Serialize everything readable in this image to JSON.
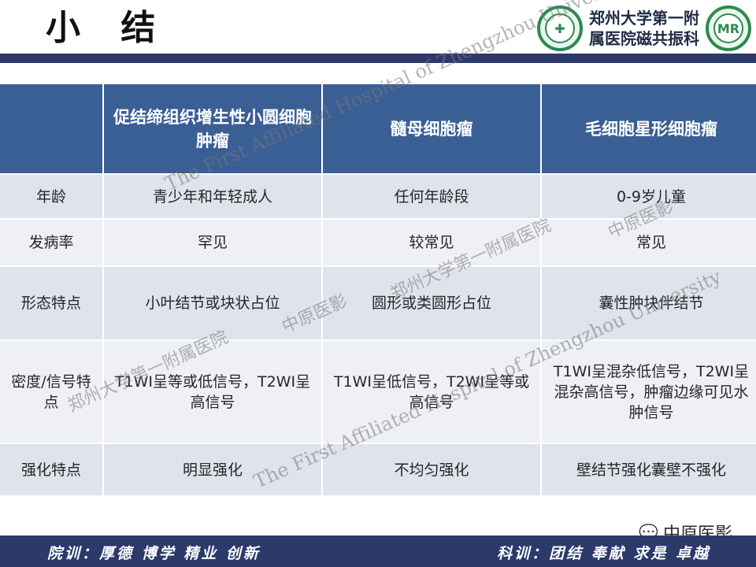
{
  "slide": {
    "title": "小 结",
    "department_lines": [
      "郑州大学第一附",
      "属医院磁共振科"
    ]
  },
  "table": {
    "columns": [
      "",
      "促结缔组织增生性小圆细胞肿瘤",
      "髓母细胞瘤",
      "毛细胞星形细胞瘤"
    ],
    "rows": [
      {
        "label": "年龄",
        "values": [
          "青少年和年轻成人",
          "任何年龄段",
          "0-9岁儿童"
        ]
      },
      {
        "label": "发病率",
        "values": [
          "罕见",
          "较常见",
          "常见"
        ]
      },
      {
        "label": "形态特点",
        "values": [
          "小叶结节或块状占位",
          "圆形或类圆形占位",
          "囊性肿块伴结节"
        ]
      },
      {
        "label": "密度/信号特点",
        "values": [
          "T1WI呈等或低信号，T2WI呈高信号",
          "T1WI呈低信号，T2WI呈等或高信号",
          "T1WI呈混杂低信号，T2WI呈混杂高信号，肿瘤边缘可见水肿信号"
        ]
      },
      {
        "label": "强化特点",
        "values": [
          "明显强化",
          "不均匀强化",
          "壁结节强化囊壁不强化"
        ]
      }
    ]
  },
  "watermarks": {
    "english": "The First Affiliated Hospital of Zhengzhou University",
    "chinese_hospital": "郑州大学第一附属医院",
    "chinese_short": "中原医影"
  },
  "footer": {
    "left_motto": "院训：厚德 博学 精业 创新",
    "right_motto": "科训：团结 奉献 求是 卓越"
  },
  "wechat": {
    "label": "中原医影",
    "icon": "wechat-icon"
  },
  "colors": {
    "header_bg": "#3a5f95",
    "band_bg": "#2b3a6b",
    "row_odd": "#dfe3ec",
    "row_even": "#eef0f5",
    "logo_green": "#2c8a4f"
  }
}
